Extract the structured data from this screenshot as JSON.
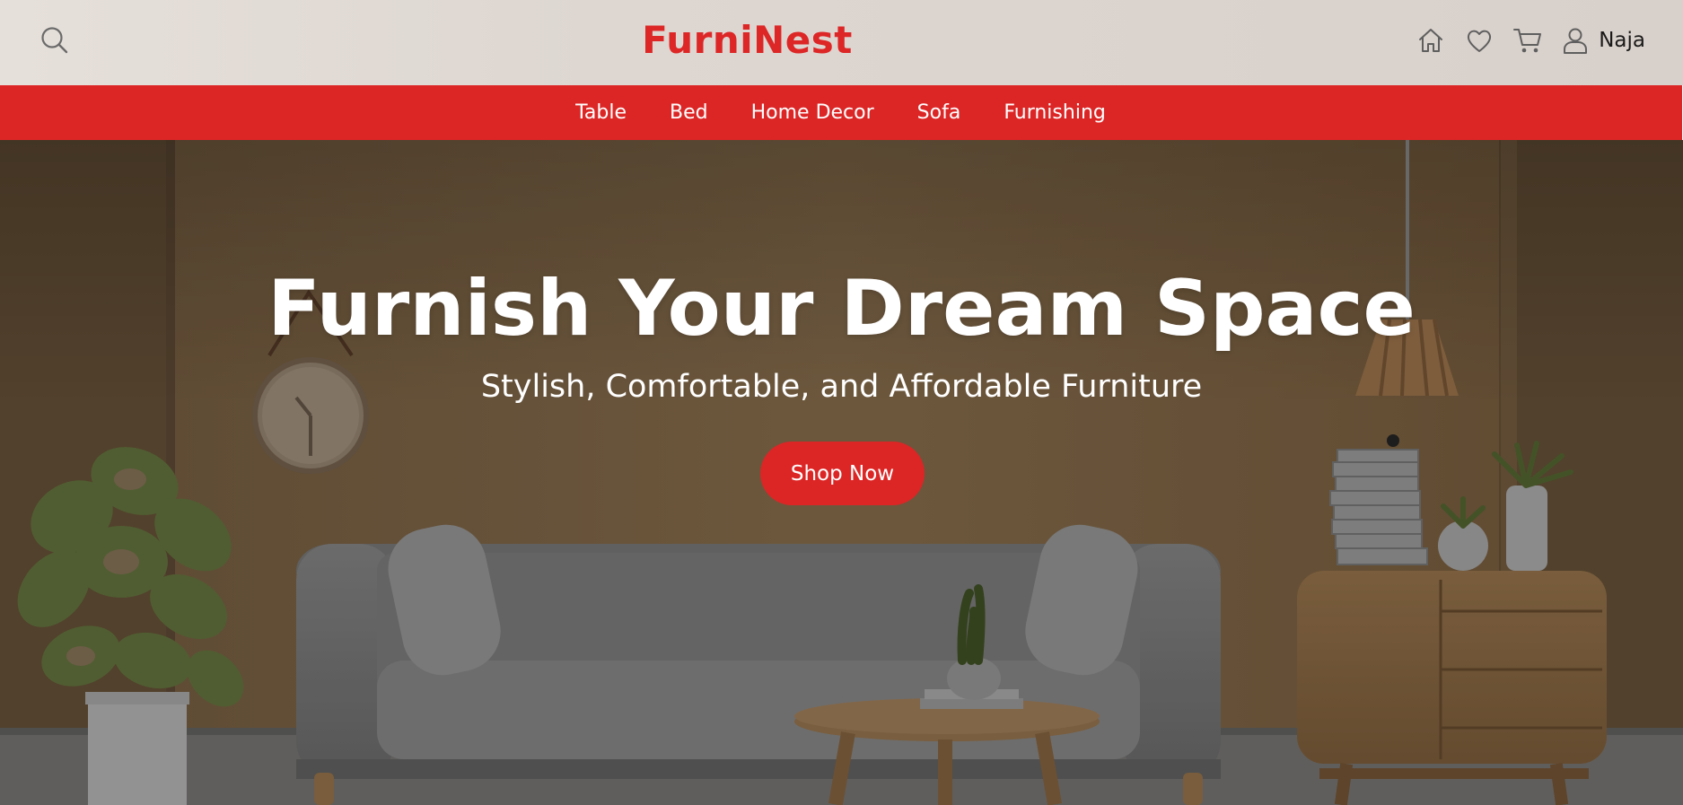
{
  "brand": {
    "name": "FurniNest",
    "color": "#dc2626"
  },
  "header": {
    "search_icon": "search-icon",
    "actions": [
      {
        "name": "home",
        "icon": "home-icon"
      },
      {
        "name": "wishlist",
        "icon": "heart-icon"
      },
      {
        "name": "cart",
        "icon": "cart-icon"
      }
    ],
    "user": {
      "icon": "user-icon",
      "name": "Naja"
    }
  },
  "nav": {
    "items": [
      {
        "label": "Table"
      },
      {
        "label": "Bed"
      },
      {
        "label": "Home Decor"
      },
      {
        "label": "Sofa"
      },
      {
        "label": "Furnishing"
      }
    ]
  },
  "hero": {
    "title": "Furnish Your Dream Space",
    "subtitle": "Stylish, Comfortable, and Affordable Furniture",
    "cta_label": "Shop Now"
  }
}
